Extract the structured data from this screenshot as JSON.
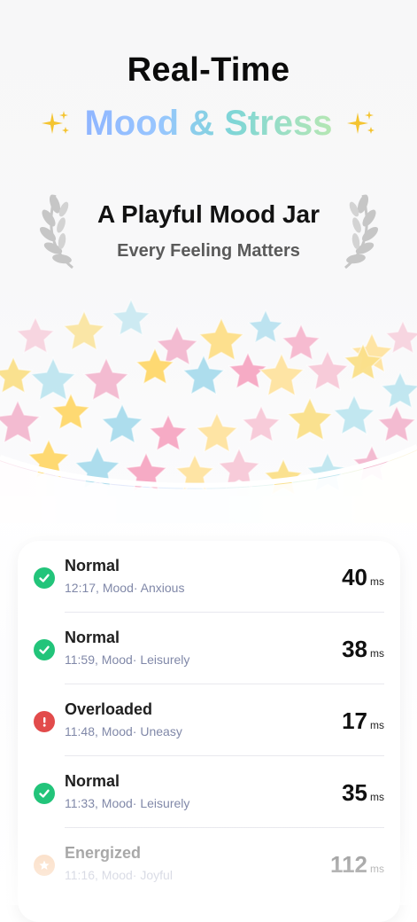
{
  "hero": {
    "title": "Real-Time",
    "subtitle": "Mood & Stress"
  },
  "award": {
    "title": "A Playful Mood Jar",
    "subtitle": "Every Feeling Matters"
  },
  "colors": {
    "normal_green": "#22c47a",
    "overloaded_red": "#e24b4b",
    "energized_orange": "#f6b37a",
    "meta_text": "#8088a8"
  },
  "list": {
    "items": [
      {
        "status": "Normal",
        "time": "12:17,",
        "mood_label": "Mood·",
        "mood": "Anxious",
        "value": "40",
        "unit": "ms",
        "icon": "check-circle-icon"
      },
      {
        "status": "Normal",
        "time": "11:59,",
        "mood_label": "Mood·",
        "mood": "Leisurely",
        "value": "38",
        "unit": "ms",
        "icon": "check-circle-icon"
      },
      {
        "status": "Overloaded",
        "time": "11:48,",
        "mood_label": "Mood·",
        "mood": "Uneasy",
        "value": "17",
        "unit": "ms",
        "icon": "alert-circle-icon"
      },
      {
        "status": "Normal",
        "time": "11:33,",
        "mood_label": "Mood·",
        "mood": "Leisurely",
        "value": "35",
        "unit": "ms",
        "icon": "check-circle-icon"
      },
      {
        "status": "Energized",
        "time": "11:16,",
        "mood_label": "Mood·",
        "mood": "Joyful",
        "value": "112",
        "unit": "ms",
        "icon": "star-circle-icon"
      }
    ]
  }
}
